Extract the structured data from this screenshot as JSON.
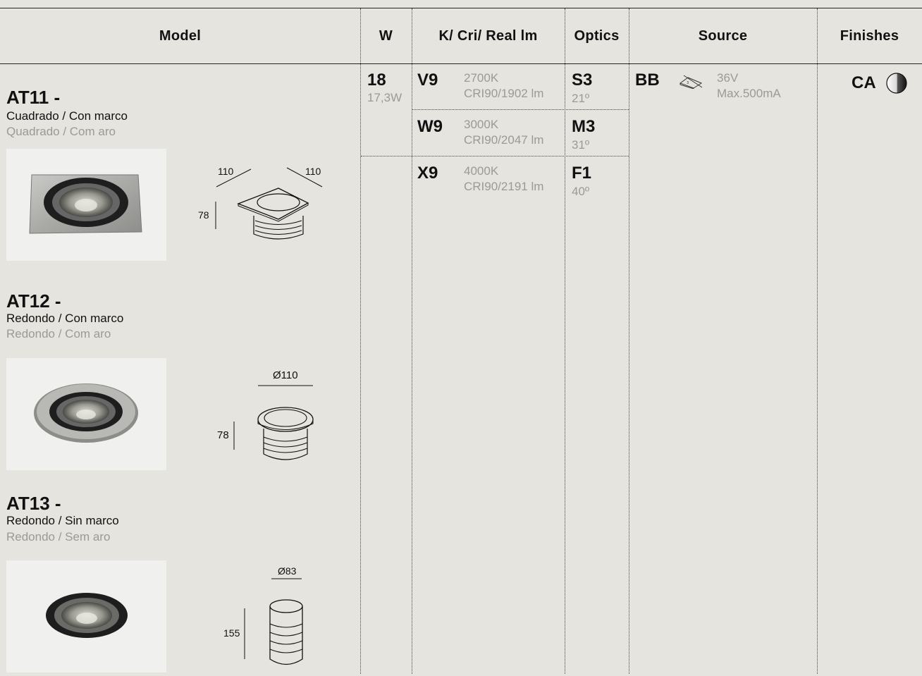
{
  "header": {
    "model": "Model",
    "w": "W",
    "kcri": "K/ Cri/ Real lm",
    "optics": "Optics",
    "source": "Source",
    "finishes": "Finishes"
  },
  "watt": {
    "value": "18",
    "real": "17,3W"
  },
  "temps": [
    {
      "code": "V9",
      "kelvin": "2700K",
      "cri": "CRI90/1902 lm"
    },
    {
      "code": "W9",
      "kelvin": "3000K",
      "cri": "CRI90/2047 lm"
    },
    {
      "code": "X9",
      "kelvin": "4000K",
      "cri": "CRI90/2191 lm"
    }
  ],
  "optics": [
    {
      "code": "S3",
      "angle": "21º"
    },
    {
      "code": "M3",
      "angle": "31º"
    },
    {
      "code": "F1",
      "angle": "40º"
    }
  ],
  "source": {
    "code": "BB",
    "voltage": "36V",
    "current": "Max.500mA",
    "icon": "driver-icon"
  },
  "finish": {
    "code": "CA",
    "icon": "finish-swatch-icon"
  },
  "models": [
    {
      "title": "AT11 -",
      "es": "Cuadrado / Con marco",
      "pt": "Quadrado / Com aro",
      "dims": {
        "w1": "110",
        "w2": "110",
        "h": "78"
      }
    },
    {
      "title": "AT12 -",
      "es": "Redondo / Con marco",
      "pt": "Redondo / Com aro",
      "dims": {
        "d": "Ø110",
        "h": "78"
      }
    },
    {
      "title": "AT13 -",
      "es": "Redondo / Sin marco",
      "pt": "Redondo / Sem aro",
      "dims": {
        "d": "Ø83",
        "h": "155"
      }
    }
  ]
}
